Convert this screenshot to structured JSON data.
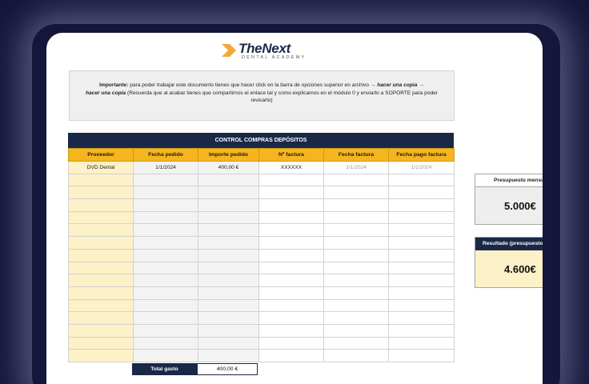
{
  "logo": {
    "name": "TheNext",
    "subtitle": "DENTAL ACADEMY",
    "mark_color": "#f2a93b"
  },
  "notice": {
    "bold_prefix": "Importante:",
    "text_1": " para poder trabajar este documento tienes que hacer click en la barra de opciones superior en  archivo → ",
    "action_1": "hacer una copia →",
    "action_2": "hacer una copia",
    "text_2": "  (Recuerda que al acabar tienes que compartirnos el enlace tal y como explicamos en el módulo 0 y enviarlo a SOPORTE para poder revisarlo)"
  },
  "sheet": {
    "title": "CONTROL COMPRAS DEPÓSITOS",
    "columns": [
      "Proveedor",
      "Fecha pedido",
      "Importe pedido",
      "Nº factura",
      "Fecha factura",
      "Fecha pago factura"
    ],
    "rows": [
      [
        "DVD Dental",
        "1/1/2024",
        "400,00 €",
        "XXXXXX",
        "1/1/2024",
        "1/1/2024"
      ],
      [
        "",
        "",
        "",
        "",
        "",
        ""
      ],
      [
        "",
        "",
        "",
        "",
        "",
        ""
      ],
      [
        "",
        "",
        "",
        "",
        "",
        ""
      ],
      [
        "",
        "",
        "",
        "",
        "",
        ""
      ],
      [
        "",
        "",
        "",
        "",
        "",
        ""
      ],
      [
        "",
        "",
        "",
        "",
        "",
        ""
      ],
      [
        "",
        "",
        "",
        "",
        "",
        ""
      ],
      [
        "",
        "",
        "",
        "",
        "",
        ""
      ],
      [
        "",
        "",
        "",
        "",
        "",
        ""
      ],
      [
        "",
        "",
        "",
        "",
        "",
        ""
      ],
      [
        "",
        "",
        "",
        "",
        "",
        ""
      ],
      [
        "",
        "",
        "",
        "",
        "",
        ""
      ],
      [
        "",
        "",
        "",
        "",
        "",
        ""
      ],
      [
        "",
        "",
        "",
        "",
        "",
        ""
      ],
      [
        "",
        "",
        "",
        "",
        "",
        ""
      ]
    ],
    "total_label": "Total gasto",
    "total_value": "400,00 €"
  },
  "summary": {
    "budget_label": "Presupuesto mensual",
    "budget_value": "5.000€",
    "result_label": "Resultado (presupuesto - gasto)",
    "result_value": "4.600€"
  },
  "colors": {
    "navy": "#1a2847",
    "header_yellow": "#f6b51e",
    "cream": "#fdf1c8",
    "background": "#15163a"
  }
}
